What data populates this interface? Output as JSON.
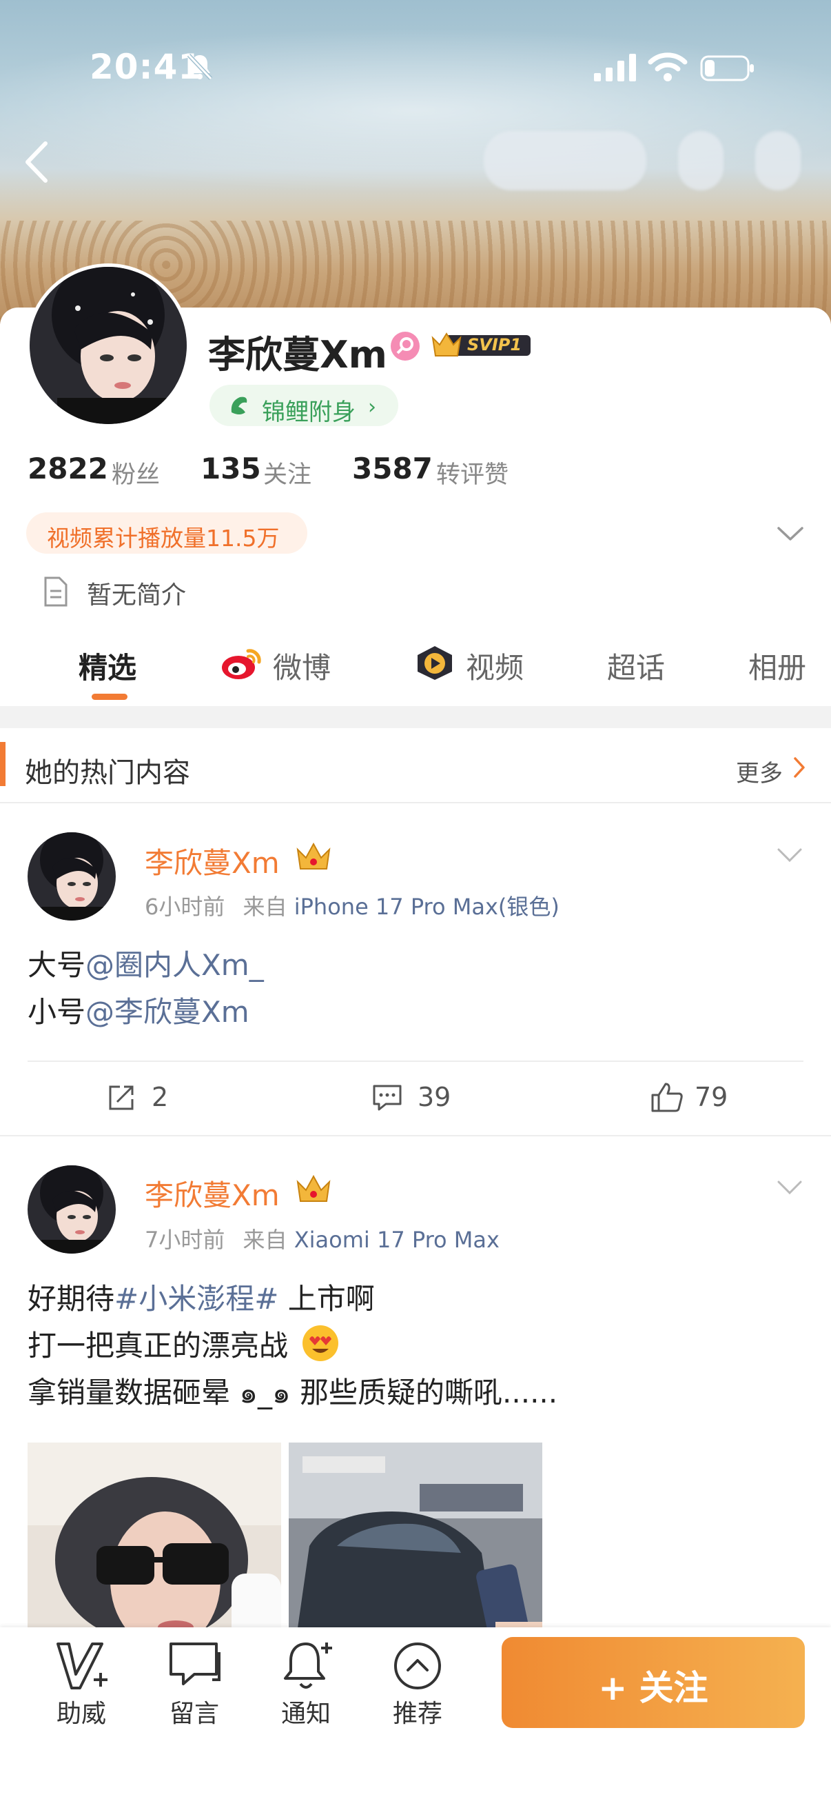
{
  "status_bar": {
    "time": "20:41"
  },
  "profile": {
    "name": "李欣蔓Xm",
    "badge": "SVIP1",
    "koi_label": "锦鲤附身",
    "stats": [
      {
        "num": "2822",
        "label": "粉丝"
      },
      {
        "num": "135",
        "label": "关注"
      },
      {
        "num": "3587",
        "label": "转评赞"
      }
    ],
    "video_plays": "视频累计播放量11.5万",
    "bio": "暂无简介"
  },
  "tabs": [
    "精选",
    "微博",
    "视频",
    "超话",
    "相册"
  ],
  "hot_section": {
    "title": "她的热门内容",
    "more": "更多"
  },
  "posts": [
    {
      "author": "李欣蔓Xm",
      "time": "6小时前",
      "source_prefix": "来自",
      "source": "iPhone 17 Pro Max(银色)",
      "line1_prefix": "大号",
      "line1_link": "@圈内人Xm_",
      "line2_prefix": "小号",
      "line2_link": "@李欣蔓Xm",
      "reposts": "2",
      "comments": "39",
      "likes": "79"
    },
    {
      "author": "李欣蔓Xm",
      "time": "7小时前",
      "source_prefix": "来自",
      "source": "Xiaomi 17 Pro Max",
      "line1_prefix": "好期待",
      "line1_link": "#小米澎程#",
      "line1_suffix": " 上市啊",
      "line2": "打一把真正的漂亮战",
      "line3": "拿销量数据砸晕 ๑_๑ 那些质疑的嘶吼......"
    }
  ],
  "bottom_bar": {
    "items": [
      "助威",
      "留言",
      "通知",
      "推荐"
    ],
    "follow": "+ 关注"
  },
  "colors": {
    "accent": "#f27b34",
    "link": "#5a6f96",
    "koi_green": "#3aa05a"
  }
}
